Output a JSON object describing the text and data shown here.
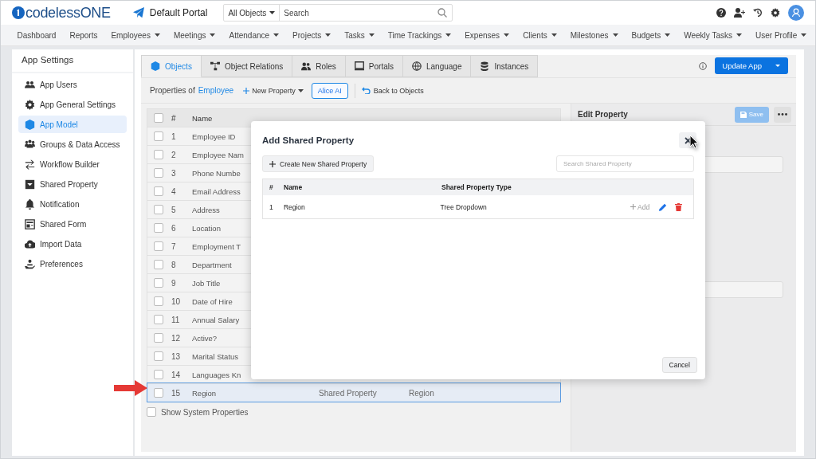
{
  "app": {
    "logo": "codelessONE",
    "portal": "Default Portal",
    "scope": "All Objects",
    "search_placeholder": "Search"
  },
  "nav": [
    {
      "label": "Dashboard",
      "dropdown": false
    },
    {
      "label": "Reports",
      "dropdown": false
    },
    {
      "label": "Employees",
      "dropdown": true
    },
    {
      "label": "Meetings",
      "dropdown": true
    },
    {
      "label": "Attendance",
      "dropdown": true
    },
    {
      "label": "Projects",
      "dropdown": true
    },
    {
      "label": "Tasks",
      "dropdown": true
    },
    {
      "label": "Time Trackings",
      "dropdown": true
    },
    {
      "label": "Expenses",
      "dropdown": true
    },
    {
      "label": "Clients",
      "dropdown": true
    },
    {
      "label": "Milestones",
      "dropdown": true
    },
    {
      "label": "Budgets",
      "dropdown": true
    },
    {
      "label": "Weekly Tasks",
      "dropdown": true
    },
    {
      "label": "User Profile",
      "dropdown": true
    }
  ],
  "sidebar": {
    "title": "App Settings",
    "items": [
      {
        "label": "App Users",
        "selected": false
      },
      {
        "label": "App General Settings",
        "selected": false
      },
      {
        "label": "App Model",
        "selected": true
      },
      {
        "label": "Groups & Data Access",
        "selected": false
      },
      {
        "label": "Workflow Builder",
        "selected": false
      },
      {
        "label": "Shared Property",
        "selected": false
      },
      {
        "label": "Notification",
        "selected": false
      },
      {
        "label": "Shared Form",
        "selected": false
      },
      {
        "label": "Import Data",
        "selected": false
      },
      {
        "label": "Preferences",
        "selected": false
      }
    ]
  },
  "tabs": [
    {
      "label": "Objects",
      "selected": true
    },
    {
      "label": "Object Relations",
      "selected": false
    },
    {
      "label": "Roles",
      "selected": false
    },
    {
      "label": "Portals",
      "selected": false
    },
    {
      "label": "Language",
      "selected": false
    },
    {
      "label": "Instances",
      "selected": false
    }
  ],
  "toolbar": {
    "prefix": "Properties of",
    "object": "Employee",
    "new_property": "New Property",
    "ai": "Alice AI",
    "back": "Back to Objects",
    "update": "Update App"
  },
  "table": {
    "select_all_checked": false,
    "columns": [
      "#",
      "Name"
    ],
    "rows": [
      {
        "number": "1",
        "name": "Employee ID",
        "checked": false,
        "selected": false
      },
      {
        "number": "2",
        "name": "Employee Nam",
        "checked": false,
        "selected": false
      },
      {
        "number": "3",
        "name": "Phone Numbe",
        "checked": false,
        "selected": false
      },
      {
        "number": "4",
        "name": "Email Address",
        "checked": false,
        "selected": false
      },
      {
        "number": "5",
        "name": "Address",
        "checked": false,
        "selected": false
      },
      {
        "number": "6",
        "name": "Location",
        "checked": false,
        "selected": false
      },
      {
        "number": "7",
        "name": "Employment T",
        "checked": false,
        "selected": false
      },
      {
        "number": "8",
        "name": "Department",
        "checked": false,
        "selected": false
      },
      {
        "number": "9",
        "name": "Job Title",
        "checked": false,
        "selected": false
      },
      {
        "number": "10",
        "name": "Date of Hire",
        "checked": false,
        "selected": false
      },
      {
        "number": "11",
        "name": "Annual Salary",
        "checked": false,
        "selected": false
      },
      {
        "number": "12",
        "name": "Active?",
        "checked": false,
        "selected": false
      },
      {
        "number": "13",
        "name": "Marital Status",
        "checked": false,
        "selected": false
      },
      {
        "number": "14",
        "name": "Languages Kn",
        "checked": false,
        "selected": false
      },
      {
        "number": "15",
        "name": "Region",
        "type": "Shared Property",
        "label": "Region",
        "checked": false,
        "selected": true
      }
    ],
    "show_system": {
      "label": "Show System Properties",
      "checked": false
    }
  },
  "edit_panel": {
    "title": "Edit Property",
    "save": "Save",
    "save_disabled": true
  },
  "modal": {
    "title": "Add Shared Property",
    "create": "Create New Shared Property",
    "search_placeholder": "Search Shared Property",
    "columns": [
      "#",
      "Name",
      "Shared Property Type"
    ],
    "rows": [
      {
        "number": "1",
        "name": "Region",
        "type": "Tree Dropdown",
        "add": "Add"
      }
    ],
    "cancel": "Cancel"
  }
}
